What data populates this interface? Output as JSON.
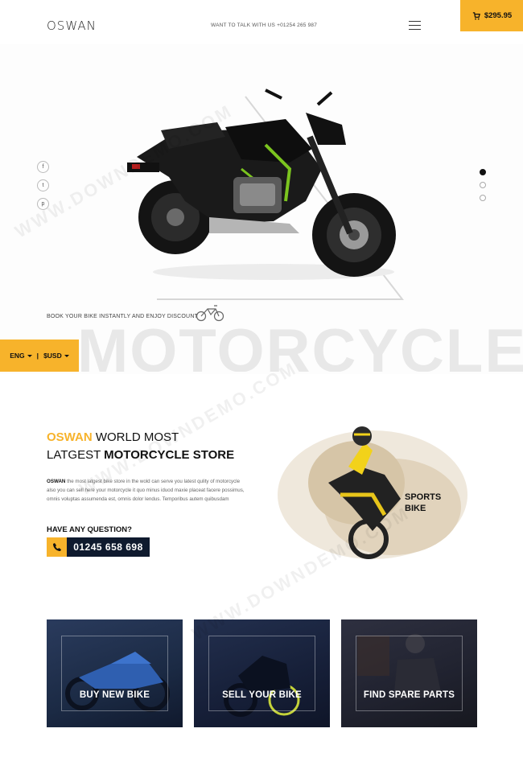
{
  "header": {
    "logo": "OSWAN",
    "contact": "WANT TO TALK WITH US +01254 265 987",
    "cart_total": "$295.95"
  },
  "hero": {
    "social": [
      "f",
      "t",
      "p"
    ],
    "tagline": "BOOK YOUR BIKE INSTANTLY AND ENJOY DISCOUNT",
    "big_word": "MOTORCYCLE",
    "language": "ENG",
    "currency": "$USD",
    "slides": 3,
    "active_slide": 1
  },
  "about": {
    "brand": "OSWAN",
    "heading_line1": "WORLD MOST",
    "heading_line2_a": "LATGEST",
    "heading_line2_b": "MOTORCYCLE STORE",
    "para_brand": "OSWAN",
    "paragraph": " the most latgest bike store in the wold can serve you latest qulity of motorcycle also you can sell here your motorcycle it quo minus iduod maxie placeat facere possimus, omnis voluptas assumenda est, omnis dolor lendus. Temporibus autem quibusdam",
    "question": "HAVE ANY QUESTION?",
    "phone": "01245 658 698",
    "badge_line1": "SPORTS",
    "badge_line2": "BIKE"
  },
  "cards": [
    {
      "label": "BUY NEW BIKE"
    },
    {
      "label": "SELL YOUR BIKE"
    },
    {
      "label": "FIND SPARE PARTS"
    }
  ],
  "colors": {
    "accent": "#f7b32b",
    "dark_navy": "#0f1a2e"
  },
  "watermark": "WWW.DOWNDEMO.COM"
}
